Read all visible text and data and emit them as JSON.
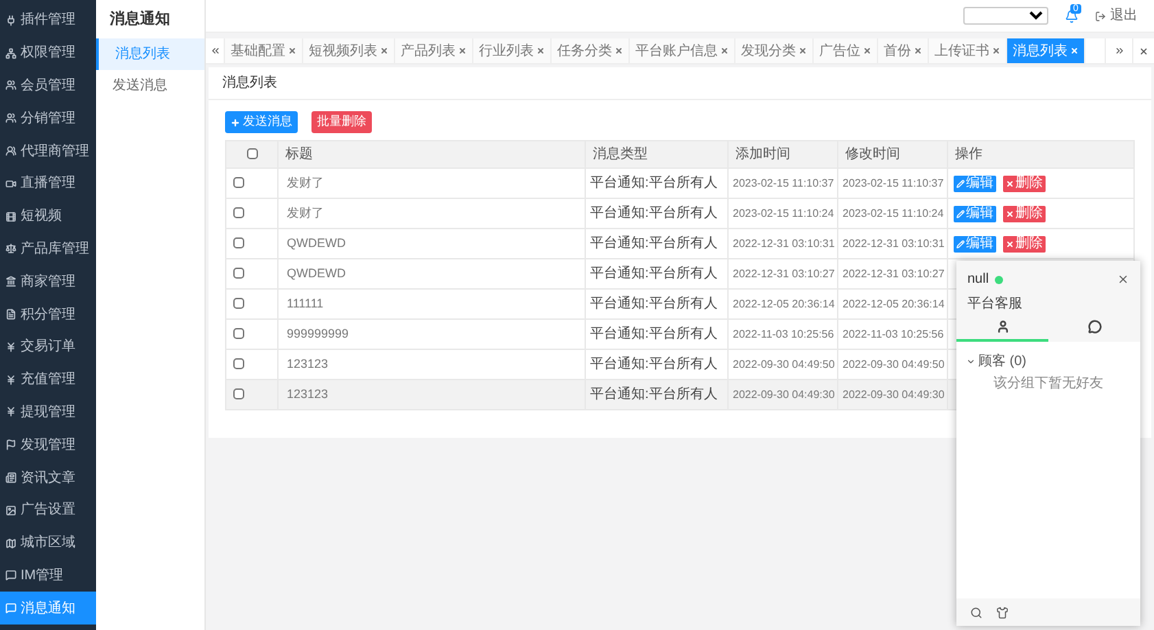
{
  "sidebar": {
    "items": [
      {
        "label": "插件管理",
        "selected": false
      },
      {
        "label": "权限管理",
        "selected": false
      },
      {
        "label": "会员管理",
        "selected": false
      },
      {
        "label": "分销管理",
        "selected": false
      },
      {
        "label": "代理商管理",
        "selected": false
      },
      {
        "label": "直播管理",
        "selected": false
      },
      {
        "label": "短视频",
        "selected": false
      },
      {
        "label": "产品库管理",
        "selected": false
      },
      {
        "label": "商家管理",
        "selected": false
      },
      {
        "label": "积分管理",
        "selected": false
      },
      {
        "label": "交易订单",
        "selected": false
      },
      {
        "label": "充值管理",
        "selected": false
      },
      {
        "label": "提现管理",
        "selected": false
      },
      {
        "label": "发现管理",
        "selected": false
      },
      {
        "label": "资讯文章",
        "selected": false
      },
      {
        "label": "广告设置",
        "selected": false
      },
      {
        "label": "城市区域",
        "selected": false
      },
      {
        "label": "IM管理",
        "selected": false
      },
      {
        "label": "消息通知",
        "selected": true
      }
    ]
  },
  "submenu": {
    "title": "消息通知",
    "items": [
      {
        "label": "消息列表",
        "selected": true
      },
      {
        "label": "发送消息",
        "selected": false
      }
    ]
  },
  "topbar": {
    "notification_count": "0",
    "logout": "退出"
  },
  "tabs": [
    {
      "label": "基础配置",
      "selected": false
    },
    {
      "label": "短视频列表",
      "selected": false
    },
    {
      "label": "产品列表",
      "selected": false
    },
    {
      "label": "行业列表",
      "selected": false
    },
    {
      "label": "任务分类",
      "selected": false
    },
    {
      "label": "平台账户信息",
      "selected": false
    },
    {
      "label": "发现分类",
      "selected": false
    },
    {
      "label": "广告位",
      "selected": false
    },
    {
      "label": "首份",
      "selected": false
    },
    {
      "label": "上传证书",
      "selected": false
    },
    {
      "label": "消息列表",
      "selected": true
    }
  ],
  "panel": {
    "title": "消息列表",
    "buttons": [
      {
        "label": "发送消息",
        "kind": "primary"
      },
      {
        "label": "批量删除",
        "kind": "danger"
      }
    ]
  },
  "table": {
    "select_all_checked": false,
    "columns": [
      "标题",
      "消息类型",
      "添加时间",
      "修改时间",
      "操作"
    ],
    "rows": [
      {
        "checked": false,
        "title": "发财了",
        "type": "平台通知:平台所有人",
        "added": "2023-02-15 11:10:37",
        "modified": "2023-02-15 11:10:37",
        "actions": [
          "编辑",
          "删除"
        ],
        "hovered": false
      },
      {
        "checked": false,
        "title": "发财了",
        "type": "平台通知:平台所有人",
        "added": "2023-02-15 11:10:24",
        "modified": "2023-02-15 11:10:24",
        "actions": [
          "编辑",
          "删除"
        ],
        "hovered": false
      },
      {
        "checked": false,
        "title": "QWDEWD",
        "type": "平台通知:平台所有人",
        "added": "2022-12-31 03:10:31",
        "modified": "2022-12-31 03:10:31",
        "actions": [
          "编辑",
          "删除"
        ],
        "hovered": false
      },
      {
        "checked": false,
        "title": "QWDEWD",
        "type": "平台通知:平台所有人",
        "added": "2022-12-31 03:10:27",
        "modified": "2022-12-31 03:10:27",
        "hovered": false
      },
      {
        "checked": false,
        "title": "111111",
        "type": "平台通知:平台所有人",
        "added": "2022-12-05 20:36:14",
        "modified": "2022-12-05 20:36:14",
        "hovered": false
      },
      {
        "checked": false,
        "title": "999999999",
        "type": "平台通知:平台所有人",
        "added": "2022-11-03 10:25:56",
        "modified": "2022-11-03 10:25:56",
        "hovered": false
      },
      {
        "checked": false,
        "title": "123123",
        "type": "平台通知:平台所有人",
        "added": "2022-09-30 04:49:50",
        "modified": "2022-09-30 04:49:50",
        "hovered": false
      },
      {
        "checked": false,
        "title": "123123",
        "type": "平台通知:平台所有人",
        "added": "2022-09-30 04:49:30",
        "modified": "2022-09-30 04:49:30",
        "hovered": true
      }
    ]
  },
  "chat": {
    "name": "null",
    "online": true,
    "subtitle": "平台客服",
    "tabs": [
      {
        "selected": true
      },
      {
        "selected": false
      }
    ],
    "group": {
      "label": "顾客 (0)",
      "expanded": true,
      "empty_text": "该分组下暂无好友"
    }
  }
}
